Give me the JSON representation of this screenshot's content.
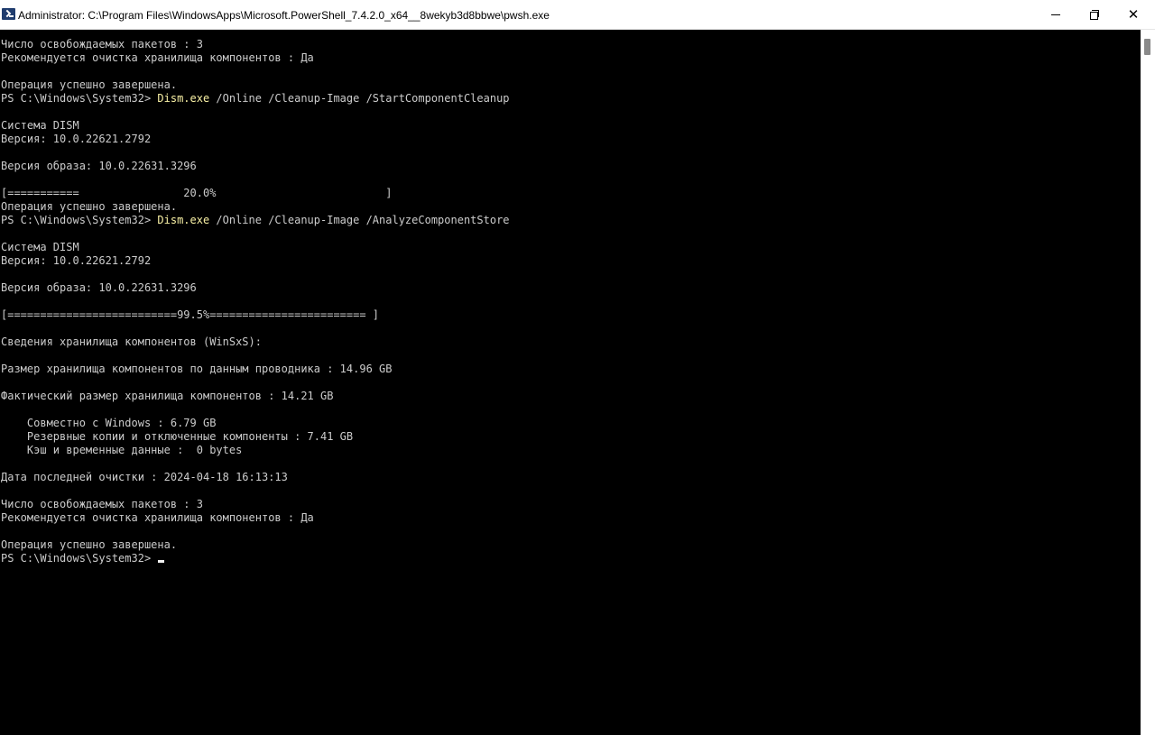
{
  "window": {
    "title": "Administrator: C:\\Program Files\\WindowsApps\\Microsoft.PowerShell_7.4.2.0_x64__8wekyb3d8bbwe\\pwsh.exe",
    "minimize_glyph": "",
    "close_glyph": "✕"
  },
  "console": {
    "prompt": "PS C:\\Windows\\System32> ",
    "lines": [
      "Число освобождаемых пакетов : 3",
      "Рекомендуется очистка хранилища компонентов : Да",
      "",
      "Операция успешно завершена.",
      {
        "cmd": "Dism.exe",
        "args": " /Online /Cleanup-Image /StartComponentCleanup"
      },
      "",
      "Система DISM",
      "Версия: 10.0.22621.2792",
      "",
      "Версия образа: 10.0.22631.3296",
      "",
      "[===========                20.0%                          ]",
      "Операция успешно завершена.",
      {
        "cmd": "Dism.exe",
        "args": " /Online /Cleanup-Image /AnalyzeComponentStore"
      },
      "",
      "Система DISM",
      "Версия: 10.0.22621.2792",
      "",
      "Версия образа: 10.0.22631.3296",
      "",
      "[==========================99.5%======================== ]",
      "",
      "Сведения хранилища компонентов (WinSxS):",
      "",
      "Размер хранилища компонентов по данным проводника : 14.96 GB",
      "",
      "Фактический размер хранилища компонентов : 14.21 GB",
      "",
      "    Совместно с Windows : 6.79 GB",
      "    Резервные копии и отключенные компоненты : 7.41 GB",
      "    Кэш и временные данные :  0 bytes",
      "",
      "Дата последней очистки : 2024-04-18 16:13:13",
      "",
      "Число освобождаемых пакетов : 3",
      "Рекомендуется очистка хранилища компонентов : Да",
      "",
      "Операция успешно завершена.",
      {
        "prompt_only": true
      }
    ]
  },
  "colors": {
    "background": "#000000",
    "text": "#cccccc",
    "command": "#f9f1a5",
    "cursor": "#f2f2f2"
  }
}
